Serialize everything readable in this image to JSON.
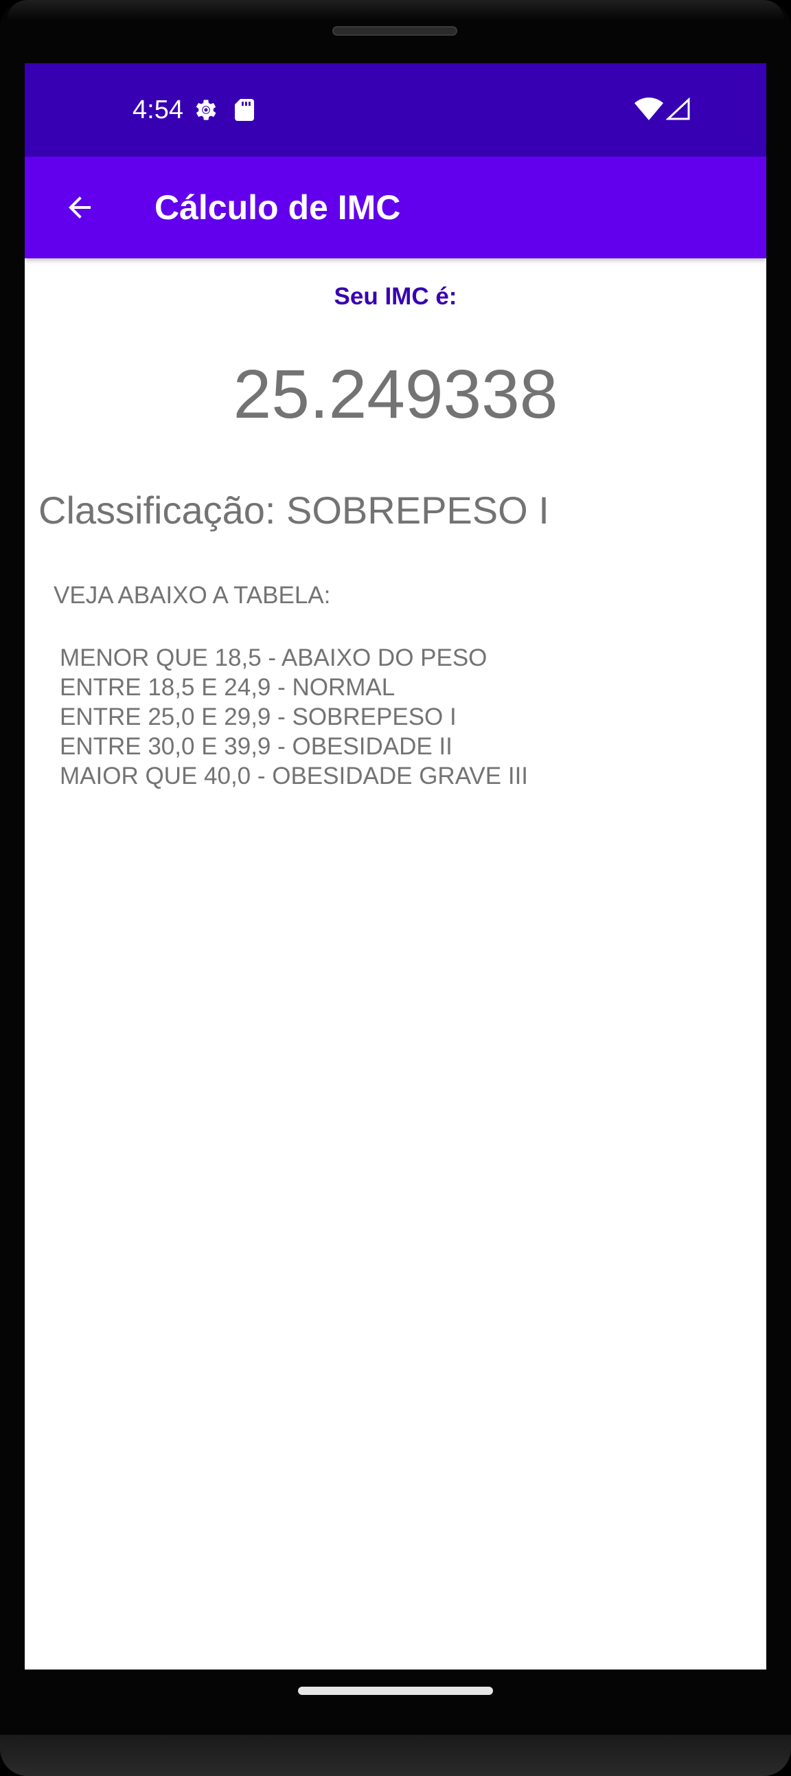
{
  "colors": {
    "status_bar": "#3700b3",
    "app_bar": "#6200ee",
    "label": "#3700b3",
    "text_gray": "#737373"
  },
  "status_bar": {
    "time": "4:54",
    "icons": [
      "gear-icon",
      "sd-card-icon",
      "wifi-icon",
      "cell-signal-icon"
    ]
  },
  "app_bar": {
    "back_icon": "arrow-back-icon",
    "title": "Cálculo de IMC"
  },
  "result": {
    "label": "Seu IMC é:",
    "value": "25.249338",
    "classification": "Classificação: SOBREPESO I"
  },
  "table": {
    "intro": "VEJA ABAIXO A TABELA:",
    "rows": [
      "MENOR QUE 18,5 - ABAIXO DO PESO",
      "ENTRE 18,5 E 24,9 - NORMAL",
      "ENTRE 25,0 E 29,9 - SOBREPESO I",
      "ENTRE 30,0 E 39,9 - OBESIDADE II",
      "MAIOR QUE 40,0 - OBESIDADE GRAVE III"
    ]
  }
}
